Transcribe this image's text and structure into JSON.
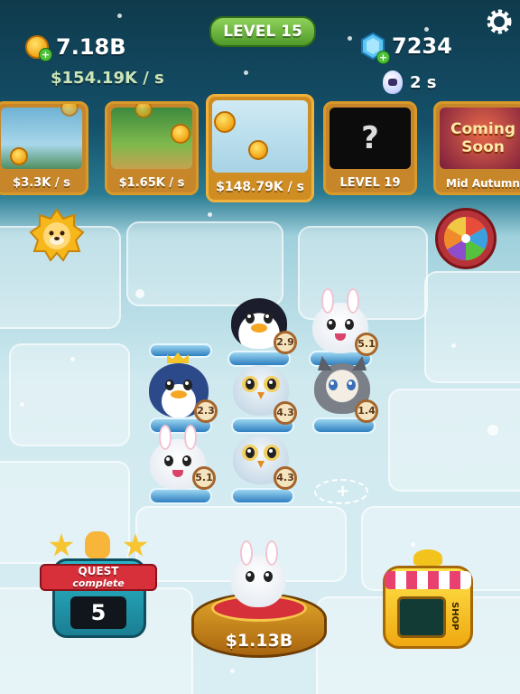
{
  "header": {
    "level_label": "LEVEL 15",
    "coins": "7.18B",
    "coin_rate": "$154.19K / s",
    "gems": "7234",
    "timer": "2 s"
  },
  "habitats": [
    {
      "label": "$3.3K / s",
      "state": "unlocked"
    },
    {
      "label": "$1.65K / s",
      "state": "unlocked"
    },
    {
      "label": "$148.79K / s",
      "state": "current"
    },
    {
      "label": "LEVEL 19",
      "state": "locked",
      "symbol": "?"
    },
    {
      "label": "Mid Autumn",
      "state": "event",
      "banner_line1": "Coming",
      "banner_line2": "Soon"
    }
  ],
  "animals": [
    {
      "kind": "penguin",
      "level": "2.9"
    },
    {
      "kind": "rabbit",
      "level": "5.1"
    },
    {
      "kind": "king-penguin",
      "level": "2.3"
    },
    {
      "kind": "owl",
      "level": "4.3"
    },
    {
      "kind": "cat",
      "level": "1.4"
    },
    {
      "kind": "rabbit",
      "level": "5.1"
    },
    {
      "kind": "owl",
      "level": "4.3"
    }
  ],
  "quest": {
    "title": "QUEST",
    "subtitle": "complete",
    "count": "5"
  },
  "buy": {
    "price": "$1.13B"
  },
  "shop": {
    "label": "SHOP"
  },
  "icons": {
    "settings": "gear-icon",
    "coin": "coin-icon",
    "gem": "gem-icon",
    "boost": "egg-timer-icon",
    "daily": "lion-sun-icon",
    "wheel": "spin-wheel-icon",
    "empty_slot": "add-slot-icon"
  },
  "colors": {
    "level_pill": "#5aa832",
    "card_border": "#d99a2a",
    "badge_border": "#a5652c",
    "price_text": "#ffffff"
  }
}
